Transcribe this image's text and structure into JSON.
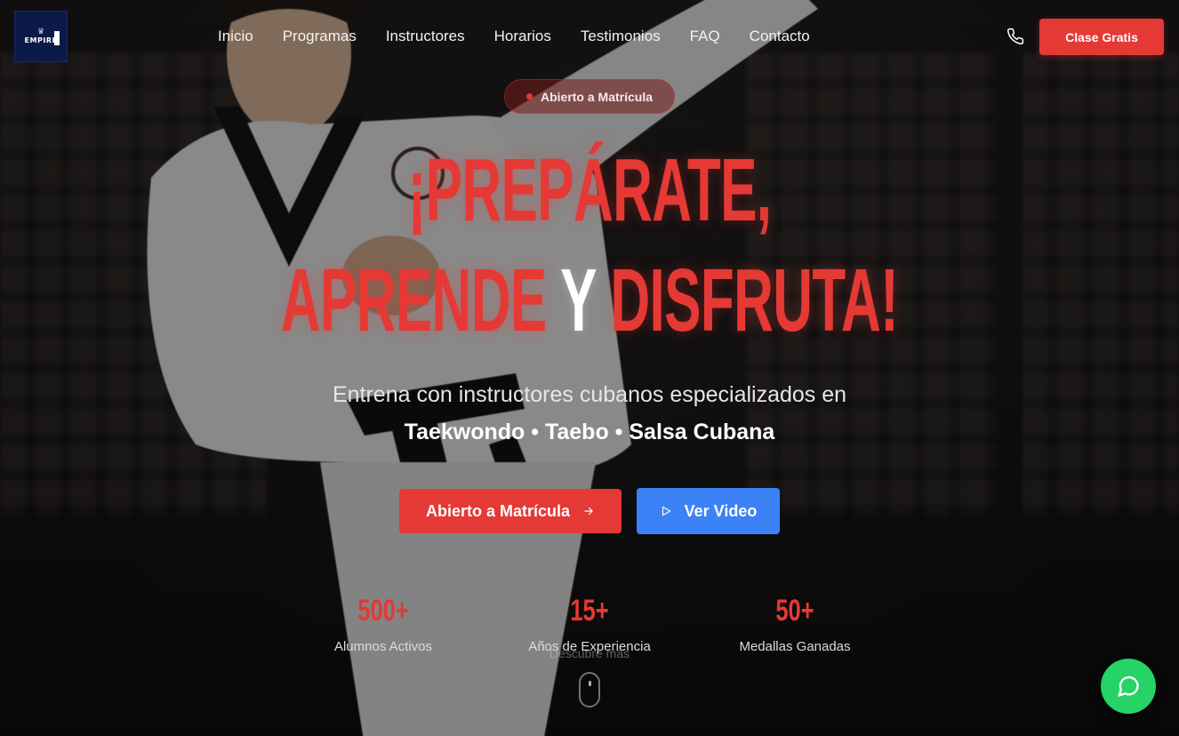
{
  "brand": {
    "logo_text": "EMPIRE"
  },
  "nav": {
    "items": [
      "Inicio",
      "Programas",
      "Instructores",
      "Horarios",
      "Testimonios",
      "FAQ",
      "Contacto"
    ]
  },
  "header": {
    "cta_label": "Clase Gratis",
    "phone_icon": "phone-icon"
  },
  "hero": {
    "badge": "Abierto a Matrícula",
    "headline_line1": "¡PREPÁRATE,",
    "headline_line2_a": "APRENDE",
    "headline_line2_b": "Y",
    "headline_line2_c": "DISFRUTA!",
    "subtitle": "Entrena con instructores cubanos especializados en",
    "disciplines": "Taekwondo • Taebo • Salsa Cubana",
    "primary_button": "Abierto a Matrícula",
    "secondary_button": "Ver Video"
  },
  "stats": [
    {
      "value": "500+",
      "label": "Alumnos Activos"
    },
    {
      "value": "15+",
      "label": "Años de Experiencia"
    },
    {
      "value": "50+",
      "label": "Medallas Ganadas"
    }
  ],
  "scroll_hint": "Descubre más",
  "colors": {
    "accent": "#e53935",
    "video_button": "#3b82f6",
    "whatsapp": "#25d366"
  }
}
